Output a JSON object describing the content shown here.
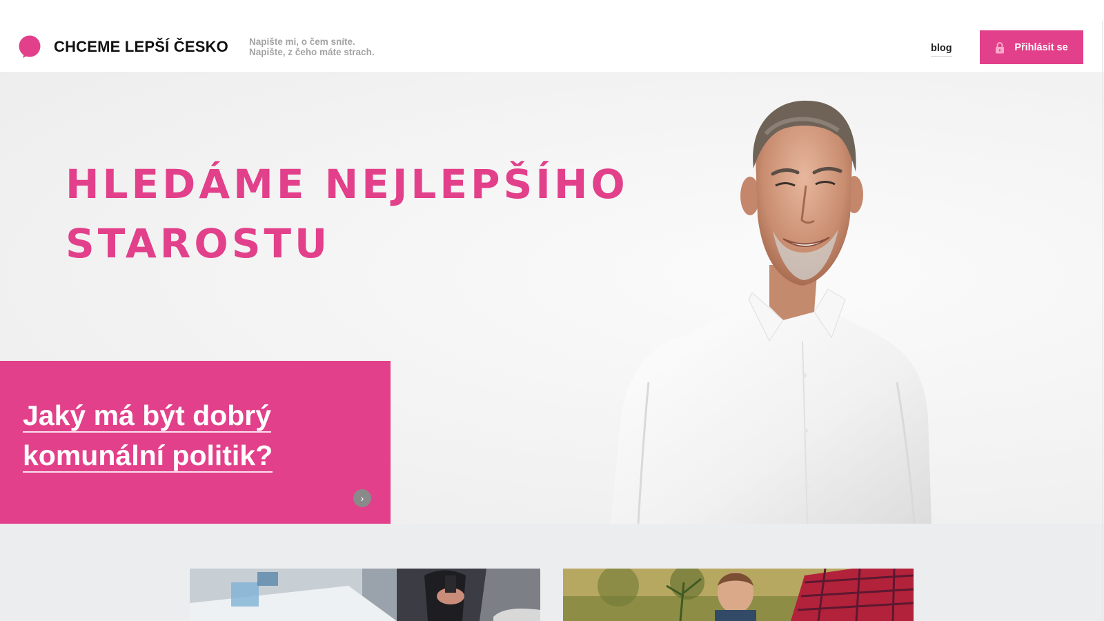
{
  "header": {
    "logo_text": "CHCEME LEPŠÍ ČESKO",
    "logo_icon": "speech-bubble-icon",
    "tagline_line1": "Napište mi, o čem sníte.",
    "tagline_line2": "Napište, z čeho máte strach.",
    "nav_blog": "blog",
    "login_label": "Přihlásit se",
    "login_icon": "lock-icon"
  },
  "hero": {
    "title_line1": "HLEDÁME NEJLEPŠÍHO",
    "title_line2": "STAROSTU",
    "teaser_line1": "Jaký má být dobrý",
    "teaser_line2": "komunální politik?",
    "next_icon": "chevron-right-icon",
    "next_glyph": "›"
  },
  "colors": {
    "accent": "#e2408a",
    "hero_bg": "#f2f2f2",
    "lower_bg": "#ecedee",
    "tagline": "#a3a3a3"
  }
}
